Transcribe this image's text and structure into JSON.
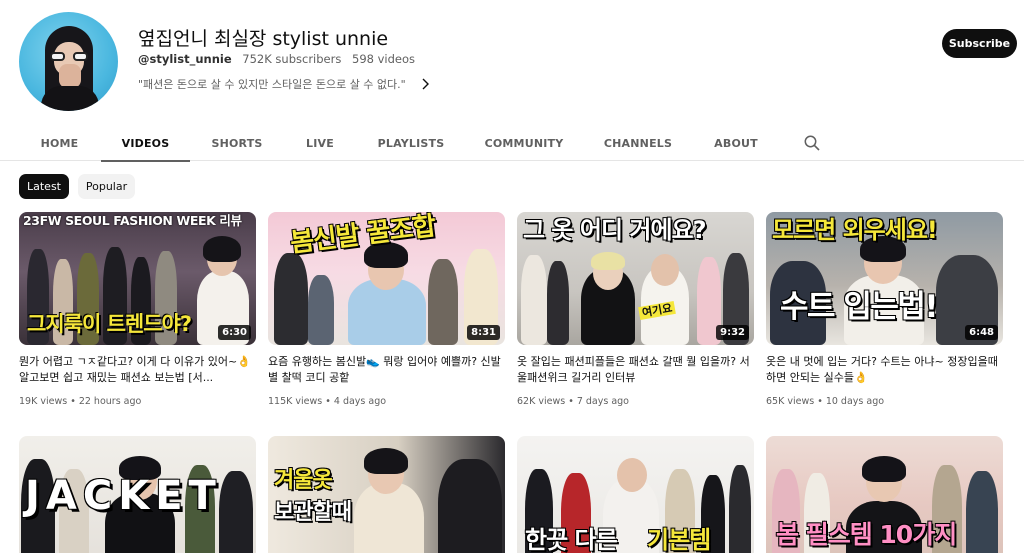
{
  "channel": {
    "name": "옆집언니 최실장 stylist unnie",
    "handle": "@stylist_unnie",
    "subscribers": "752K subscribers",
    "video_count": "598 videos",
    "description": "\"패션은 돈으로 살 수 있지만 스타일은 돈으로 살 수 없다.\"",
    "subscribe_label": "Subscribe"
  },
  "tabs": [
    "HOME",
    "VIDEOS",
    "SHORTS",
    "LIVE",
    "PLAYLISTS",
    "COMMUNITY",
    "CHANNELS",
    "ABOUT"
  ],
  "active_tab": "VIDEOS",
  "chips": [
    "Latest",
    "Popular"
  ],
  "active_chip": "Latest",
  "icons": {
    "search": "search-icon",
    "expand": "chevron-right-icon"
  },
  "colors": {
    "accent_dark": "#0f0f0f",
    "meta_gray": "#606060",
    "chip_bg": "#f2f2f2",
    "thumb_yellow": "#f5e73a"
  },
  "videos": [
    {
      "thumb_text": [
        "23FW SEOUL FASHION WEEK 리뷰",
        "그지룩이 트렌드야?"
      ],
      "duration": "6:30",
      "title": "뭔가 어렵고 ㄱㅈ같다고? 이게 다 이유가 있어~👌알고보면 쉽고 재밌는 패션쇼 보는법 [서...",
      "views": "19K views",
      "age": "22 hours ago"
    },
    {
      "thumb_text": [
        "봄신발 꿀조합"
      ],
      "duration": "8:31",
      "title": "요즘 유행하는 봄신발👟 뭐랑 입어야 예쁠까? 신발별 찰떡 코디 공핱",
      "views": "115K views",
      "age": "4 days ago"
    },
    {
      "thumb_text": [
        "그 옷 어디 거에요?",
        "여기요"
      ],
      "duration": "9:32",
      "title": "옷 잘입는 패션피플들은 패션쇼 갈땐 뭘 입을까? 서울패션위크 길거리 인터뷰",
      "views": "62K views",
      "age": "7 days ago"
    },
    {
      "thumb_text": [
        "모르면 외우세요!",
        "수트 입는법!"
      ],
      "duration": "6:48",
      "title": "옷은 내 멋에 입는 거다? 수트는 아냐~ 정장입을때 하면 안되는 실수들👌",
      "views": "65K views",
      "age": "10 days ago"
    },
    {
      "thumb_text": [
        "JACKET"
      ]
    },
    {
      "thumb_text": [
        "겨울옷",
        "보관할때"
      ]
    },
    {
      "thumb_text": [
        "한끗 다른",
        "기본템"
      ]
    },
    {
      "thumb_text": [
        "봄 필스템 10가지"
      ]
    }
  ]
}
